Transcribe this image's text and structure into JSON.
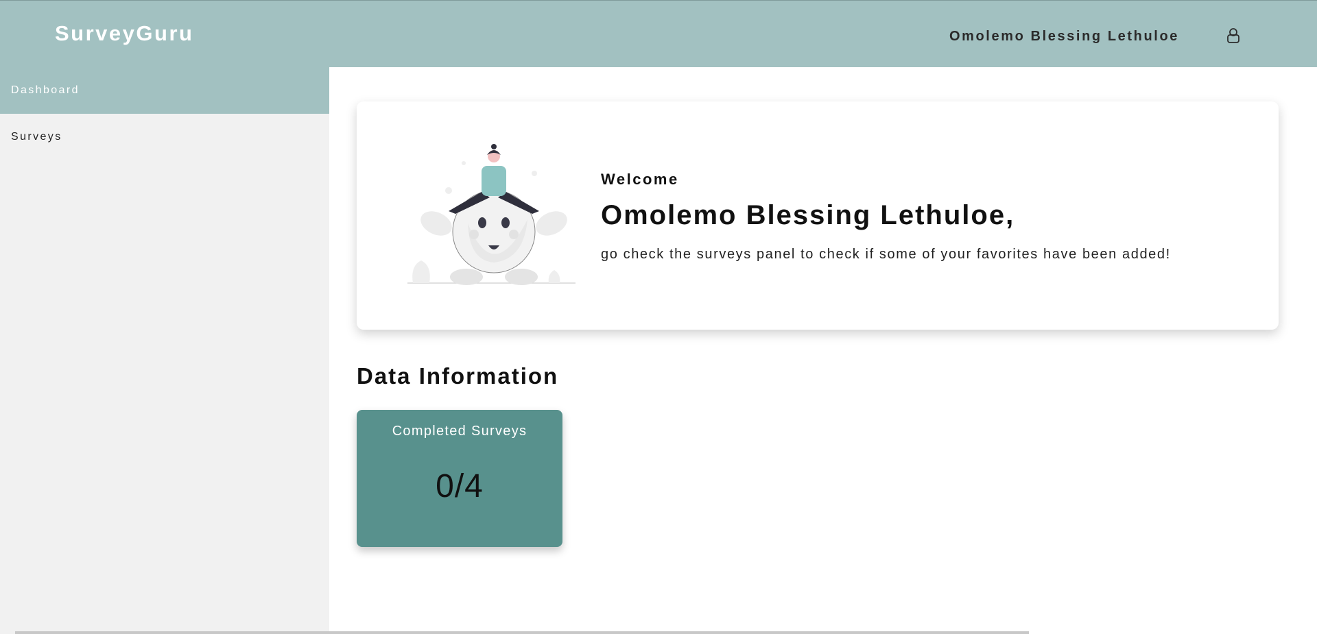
{
  "app": {
    "brand": "SurveyGuru"
  },
  "header": {
    "user_name": "Omolemo Blessing Lethuloe",
    "user_icon": "user-icon"
  },
  "sidebar": {
    "items": [
      {
        "label": "Dashboard",
        "active": true
      },
      {
        "label": "Surveys",
        "active": false
      }
    ]
  },
  "welcome": {
    "label": "Welcome",
    "name": "Omolemo Blessing Lethuloe,",
    "message": "go check the surveys panel to check if some of your favorites have been added!"
  },
  "data_section": {
    "title": "Data Information",
    "cards": [
      {
        "title": "Completed Surveys",
        "value": "0/4"
      }
    ]
  },
  "colors": {
    "header": "#a2c1c1",
    "sidebar": "#f1f1f1",
    "card": "#58918d"
  }
}
